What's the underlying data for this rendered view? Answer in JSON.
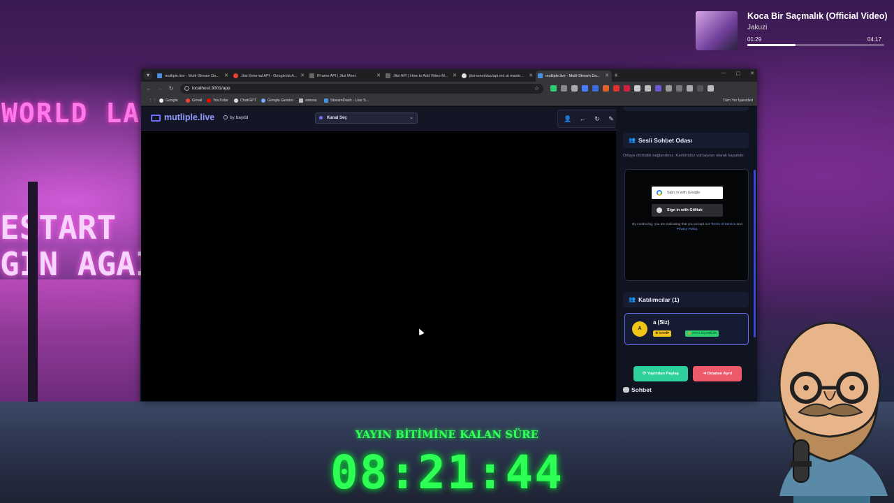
{
  "now_playing": {
    "title": "Koca Bir Saçmalık (Official Video)",
    "artist": "Jakuzi",
    "current_time": "01:29",
    "duration": "04:17",
    "progress": 0.35
  },
  "countdown": {
    "label": "YAYIN BİTİMİNE KALAN SÜRE",
    "time": "08:21:44"
  },
  "background": {
    "sign_top": "WORLD LA",
    "sign_mid1": "ESTART",
    "sign_mid2": "GIN AGAIN"
  },
  "browser": {
    "tabs": [
      {
        "label": "mutliple.live - Multi-Stream Da...",
        "active": false
      },
      {
        "label": "Jitsi External API - Google'da A...",
        "active": false
      },
      {
        "label": "IFrame API | Jitsi Meet",
        "active": false
      },
      {
        "label": "Jitsi API | How to Add Video M...",
        "active": false
      },
      {
        "label": "jitsi-meet/doc/api.md at maste...",
        "active": false
      },
      {
        "label": "mutliple.live - Multi-Stream Da...",
        "active": true
      }
    ],
    "url": "localhost:3001/app",
    "bookmarks": [
      "Google",
      "Gmail",
      "YouTube",
      "ChatGPT",
      "Google Gemini",
      "ssssss",
      "StreamDash - Live S..."
    ],
    "all_bookmarks": "Tüm Yer İşaretleri"
  },
  "app": {
    "logo": "mutliple.live",
    "byline": "by baydd",
    "channel_select": "Kanal Seç"
  },
  "panel": {
    "audio_title": "Sesli Sohbet Odası",
    "audio_desc": "Odaya otomatik bağlandınız. Kameranız varsayılan olarak kapalıdır.",
    "google_btn": "Sign in with Google",
    "github_btn": "Sign in with GitHub",
    "terms_pre": "By continuing, you are indicating that you accept our",
    "terms_link": "Terms of Service",
    "terms_and": "and",
    "privacy_link": "Privacy Policy.",
    "participants_title": "Katılımcılar (1)",
    "participant": {
      "initial": "A",
      "name": "a (Siz)",
      "badge_owner": "★ SAHİP",
      "badge_share": "🔒 PAYLAŞABİLİR"
    },
    "share_btn": "Yayından Paylaş",
    "leave_btn": "Odadan Ayrıl",
    "chat_title": "Sohbet"
  }
}
